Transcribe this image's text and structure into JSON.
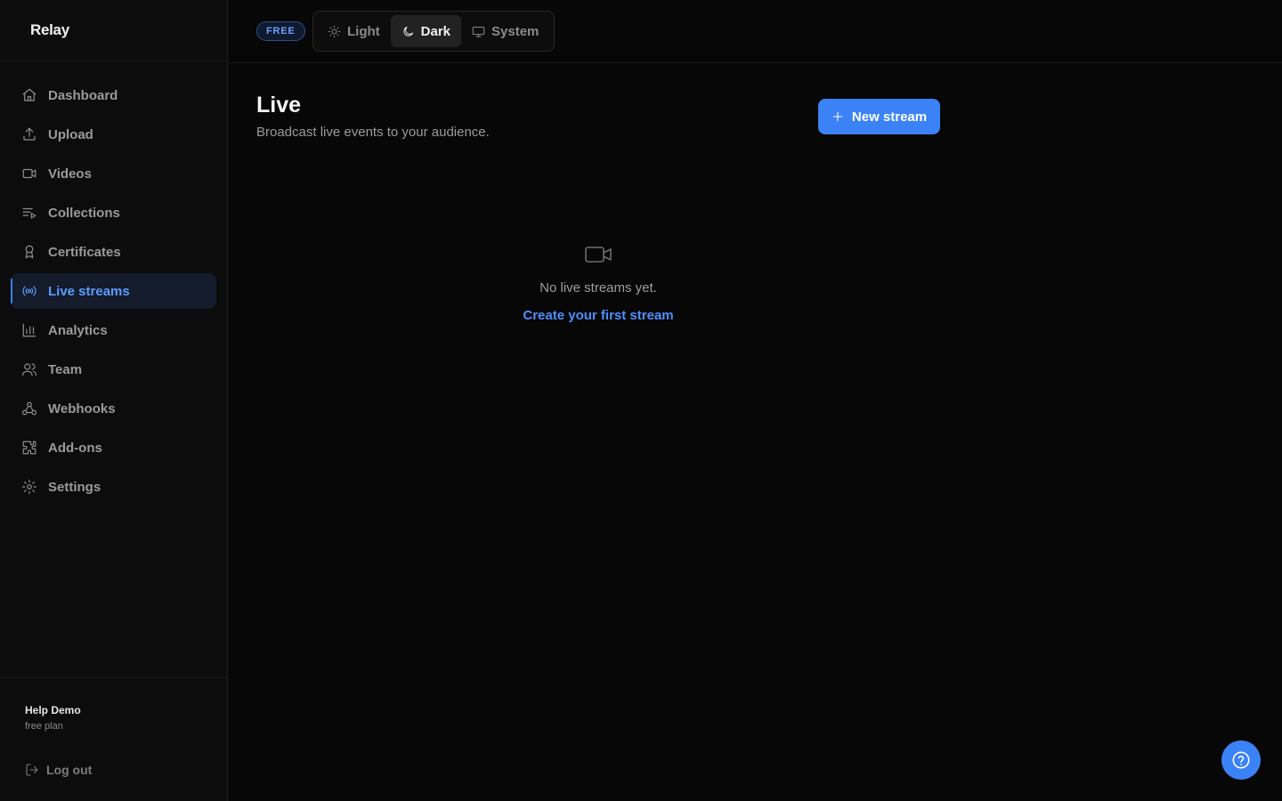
{
  "brand": {
    "name": "Relay"
  },
  "topbar": {
    "plan_badge": "FREE",
    "theme": {
      "options": [
        {
          "label": "Light",
          "icon": "sun-icon"
        },
        {
          "label": "Dark",
          "icon": "moon-icon"
        },
        {
          "label": "System",
          "icon": "monitor-icon"
        }
      ],
      "selected": "Dark"
    }
  },
  "sidebar": {
    "items": [
      {
        "label": "Dashboard",
        "icon": "home-icon"
      },
      {
        "label": "Upload",
        "icon": "upload-icon"
      },
      {
        "label": "Videos",
        "icon": "video-icon"
      },
      {
        "label": "Collections",
        "icon": "list-icon"
      },
      {
        "label": "Certificates",
        "icon": "award-icon"
      },
      {
        "label": "Live streams",
        "icon": "broadcast-icon",
        "active": true
      },
      {
        "label": "Analytics",
        "icon": "bar-chart-icon"
      },
      {
        "label": "Team",
        "icon": "users-icon"
      },
      {
        "label": "Webhooks",
        "icon": "webhook-icon"
      },
      {
        "label": "Add-ons",
        "icon": "puzzle-icon"
      },
      {
        "label": "Settings",
        "icon": "gear-icon"
      }
    ],
    "user": {
      "name": "Help Demo",
      "plan": "free plan"
    },
    "logout_label": "Log out"
  },
  "main": {
    "title": "Live",
    "subtitle": "Broadcast live events to your audience.",
    "new_button_label": "New stream",
    "empty_state": {
      "icon": "video-icon",
      "text": "No live streams yet.",
      "link": "Create your first stream"
    }
  },
  "help_button": {
    "icon": "help-circle-icon"
  },
  "colors": {
    "accent": "#3b82f6",
    "accent_text": "#5b9bff",
    "background": "#070707",
    "sidebar": "#0c0c0c"
  }
}
